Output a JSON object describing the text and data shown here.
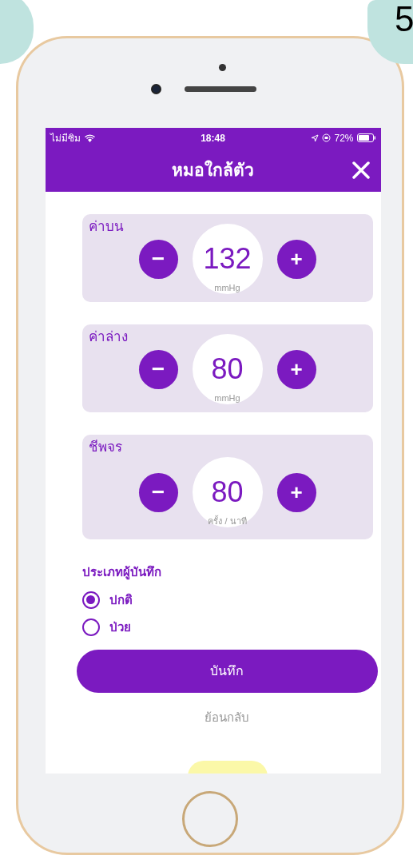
{
  "step_badge": {
    "text": "5"
  },
  "status_bar": {
    "carrier": "ไม่มีซิม",
    "time": "18:48",
    "battery": "72%"
  },
  "header": {
    "title": "หมอใกล้ตัว"
  },
  "measurements": [
    {
      "label": "ค่าบน",
      "value": "132",
      "unit": "mmHg",
      "minus": "−",
      "plus": "+"
    },
    {
      "label": "ค่าล่าง",
      "value": "80",
      "unit": "mmHg",
      "minus": "−",
      "plus": "+"
    },
    {
      "label": "ชีพจร",
      "value": "80",
      "unit": "ครั้ง / นาที",
      "minus": "−",
      "plus": "+"
    }
  ],
  "record_type": {
    "title": "ประเภทผู้บันทึก",
    "options": [
      {
        "label": "ปกติ",
        "selected": true
      },
      {
        "label": "ป่วย",
        "selected": false
      }
    ]
  },
  "save_button": "บันทึก",
  "back_link": "ย้อนกลับ"
}
